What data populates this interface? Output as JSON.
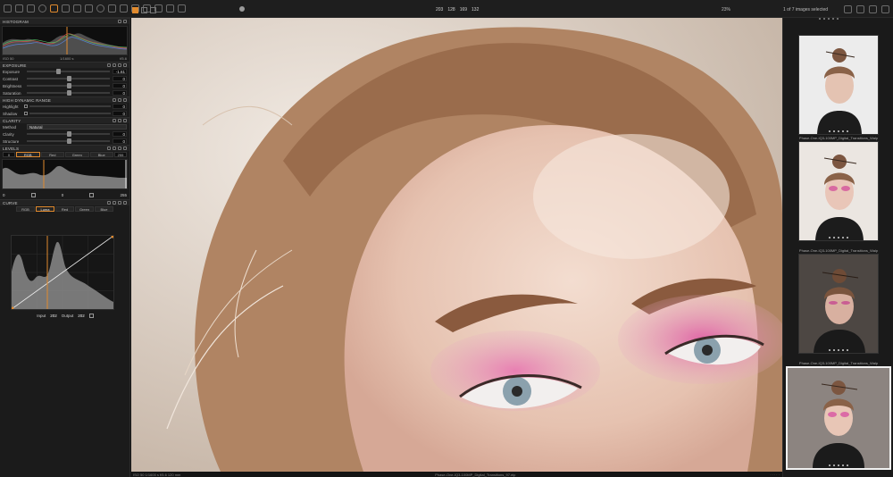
{
  "toolbar": {
    "view_readout": [
      "203",
      "128",
      "169",
      "132"
    ],
    "zoom_label": "23%",
    "selection_label": "1 of 7 images selected"
  },
  "panels": {
    "histogram": {
      "title": "HISTOGRAM",
      "iso": "ISO 50",
      "shutter": "1/1600 s",
      "aperture": "f/5.6"
    },
    "exposure": {
      "title": "EXPOSURE",
      "rows": [
        {
          "label": "Exposure",
          "value": "-1.61",
          "pos": 0.35
        },
        {
          "label": "Contrast",
          "value": "0",
          "pos": 0.5
        },
        {
          "label": "Brightness",
          "value": "0",
          "pos": 0.5
        },
        {
          "label": "Saturation",
          "value": "0",
          "pos": 0.5
        }
      ]
    },
    "hdr": {
      "title": "HIGH DYNAMIC RANGE",
      "rows": [
        {
          "label": "Highlight",
          "value": "0"
        },
        {
          "label": "Shadow",
          "value": "0"
        }
      ]
    },
    "clarity": {
      "title": "CLARITY",
      "method_label": "Method",
      "method_value": "Natural",
      "rows": [
        {
          "label": "Clarity",
          "value": "0"
        },
        {
          "label": "Structure",
          "value": "0"
        }
      ]
    },
    "levels": {
      "title": "LEVELS",
      "left_value": "0",
      "right_value": "255",
      "channels": [
        "RGB",
        "Red",
        "Green",
        "Blue"
      ],
      "active": "RGB",
      "out_low": "0",
      "out_mid": "0",
      "out_high": "255"
    },
    "curve": {
      "title": "CURVE",
      "channels": [
        "RGB",
        "Luma",
        "Red",
        "Green",
        "Blue"
      ],
      "active": "Luma",
      "input_label": "Input",
      "input_value": "202",
      "output_label": "Output",
      "output_value": "202"
    }
  },
  "viewer": {
    "status_left": "ISO 50 1/1600 s f/5.6 120 mm",
    "status_center": "Phase-One-IQ3-100MP_Digital_Transitions_97.eip",
    "rating_stars": 0
  },
  "filmstrip": {
    "items": [
      {
        "title": "",
        "selected": false
      },
      {
        "title": "Phase-One-IQ3-100MP_Digital_Transitions_Walp",
        "selected": false
      },
      {
        "title": "Phase-One-IQ3-100MP_Digital_Transitions_Walp",
        "selected": false
      },
      {
        "title": "Phase-One-IQ3-100MP_Digital_Transitions_Walp",
        "selected": true
      }
    ]
  },
  "colors": {
    "accent": "#e08a2e",
    "panel_bg": "#1b1b1b"
  }
}
